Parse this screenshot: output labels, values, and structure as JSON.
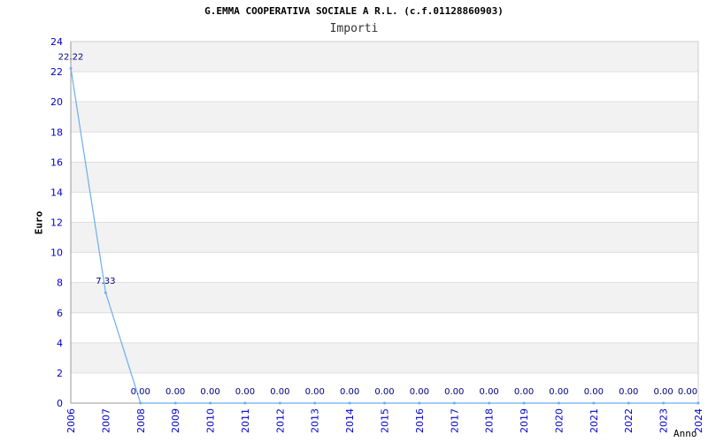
{
  "chart_data": {
    "type": "line",
    "title": "G.EMMA COOPERATIVA SOCIALE A R.L. (c.f.01128860903)",
    "subtitle": "Importi",
    "xlabel": "Anno",
    "ylabel": "Euro",
    "x": [
      "2006",
      "2007",
      "2008",
      "2009",
      "2010",
      "2011",
      "2012",
      "2013",
      "2014",
      "2015",
      "2016",
      "2017",
      "2018",
      "2019",
      "2020",
      "2021",
      "2022",
      "2023",
      "2024"
    ],
    "values": [
      22.22,
      7.33,
      0.0,
      0.0,
      0.0,
      0.0,
      0.0,
      0.0,
      0.0,
      0.0,
      0.0,
      0.0,
      0.0,
      0.0,
      0.0,
      0.0,
      0.0,
      0.0,
      0.0
    ],
    "data_labels": [
      "22.22",
      "7.33",
      "0.00",
      "0.00",
      "0.00",
      "0.00",
      "0.00",
      "0.00",
      "0.00",
      "0.00",
      "0.00",
      "0.00",
      "0.00",
      "0.00",
      "0.00",
      "0.00",
      "0.00",
      "0.00",
      "0.00"
    ],
    "ylim": [
      0,
      24
    ],
    "yticks": [
      0,
      2,
      4,
      6,
      8,
      10,
      12,
      14,
      16,
      18,
      20,
      22,
      24
    ],
    "grid": "horizontal alternating bands",
    "colors": {
      "line": "#6aaef0",
      "band": "#f2f2f2",
      "tick": "#0000cc",
      "data_label": "#000080"
    }
  }
}
